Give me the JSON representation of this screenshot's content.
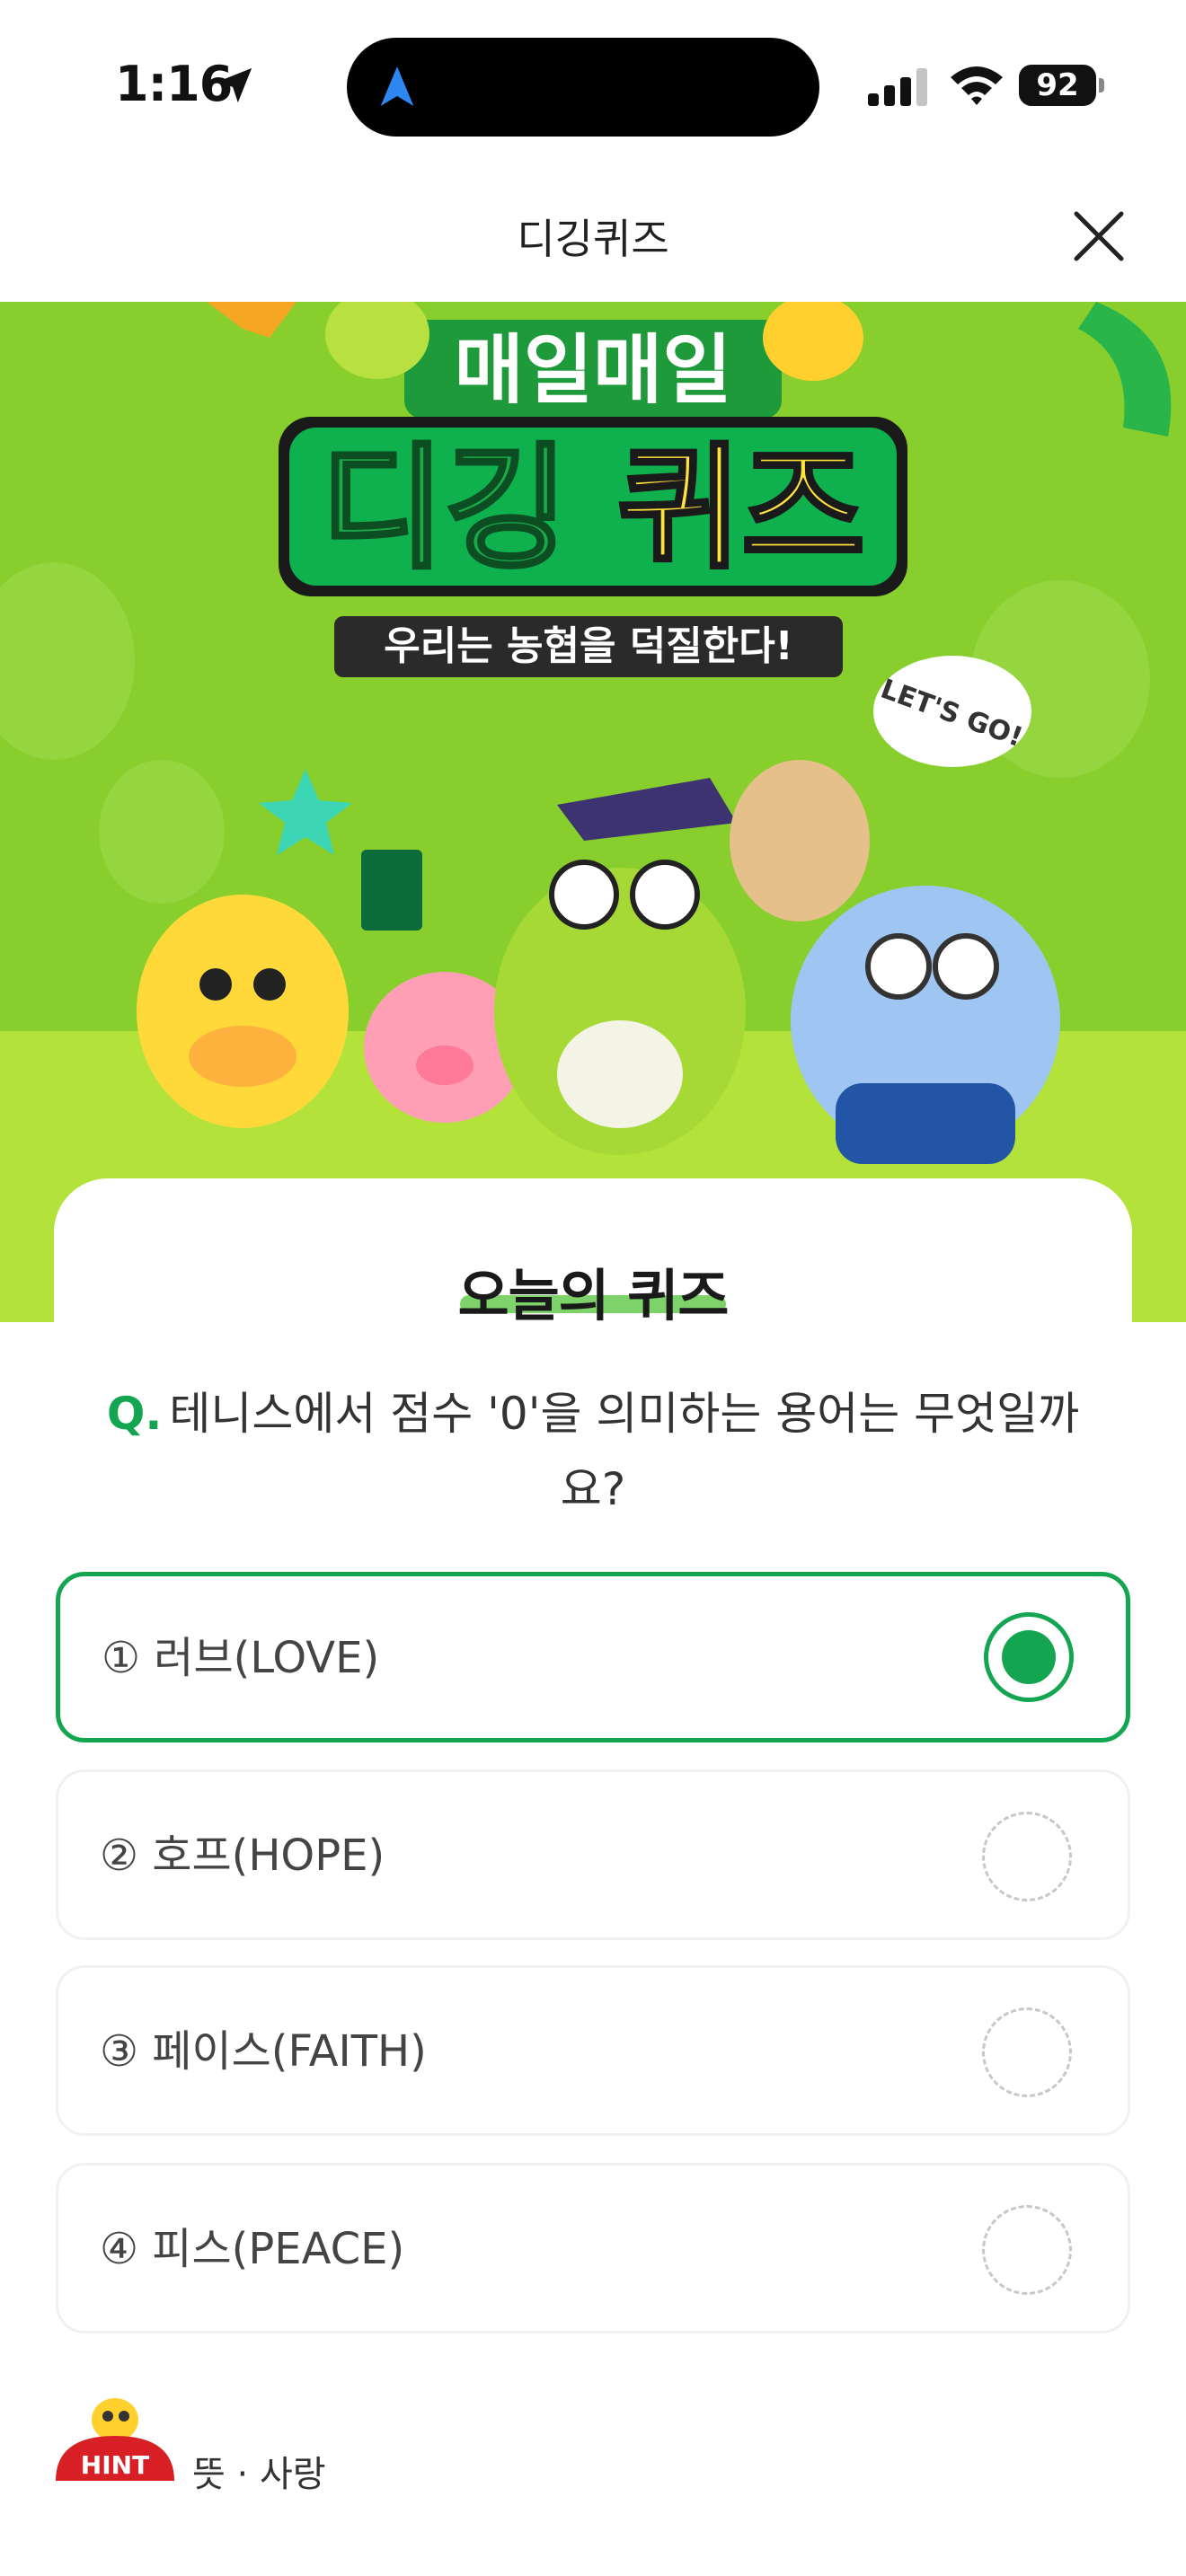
{
  "status_bar": {
    "time": "1:16",
    "battery": "92"
  },
  "header": {
    "title": "디깅퀴즈"
  },
  "banner": {
    "top_text": "매일매일",
    "title_green": "디깅",
    "title_yellow": "퀴즈",
    "subtitle": "우리는 농협을 덕질한다!",
    "bubble": "LET'S GO!"
  },
  "quiz": {
    "section_title": "오늘의 퀴즈",
    "question_prefix": "Q.",
    "question": "테니스에서 점수 '0'을 의미하는 용어는 무엇일까요?",
    "options": [
      {
        "label": "① 러브(LOVE)",
        "selected": true
      },
      {
        "label": "② 호프(HOPE)",
        "selected": false
      },
      {
        "label": "③ 페이스(FAITH)",
        "selected": false
      },
      {
        "label": "④ 피스(PEACE)",
        "selected": false
      }
    ],
    "hint_badge": "HINT",
    "hint_text": "뜻 · 사랑"
  },
  "colors": {
    "accent": "#13a550",
    "banner_bg": "#8bd42e",
    "title_yellow": "#ffe23d"
  },
  "icons": [
    "location-arrow-icon",
    "navigation-icon",
    "signal-icon",
    "wifi-icon",
    "battery-icon",
    "close-icon"
  ]
}
